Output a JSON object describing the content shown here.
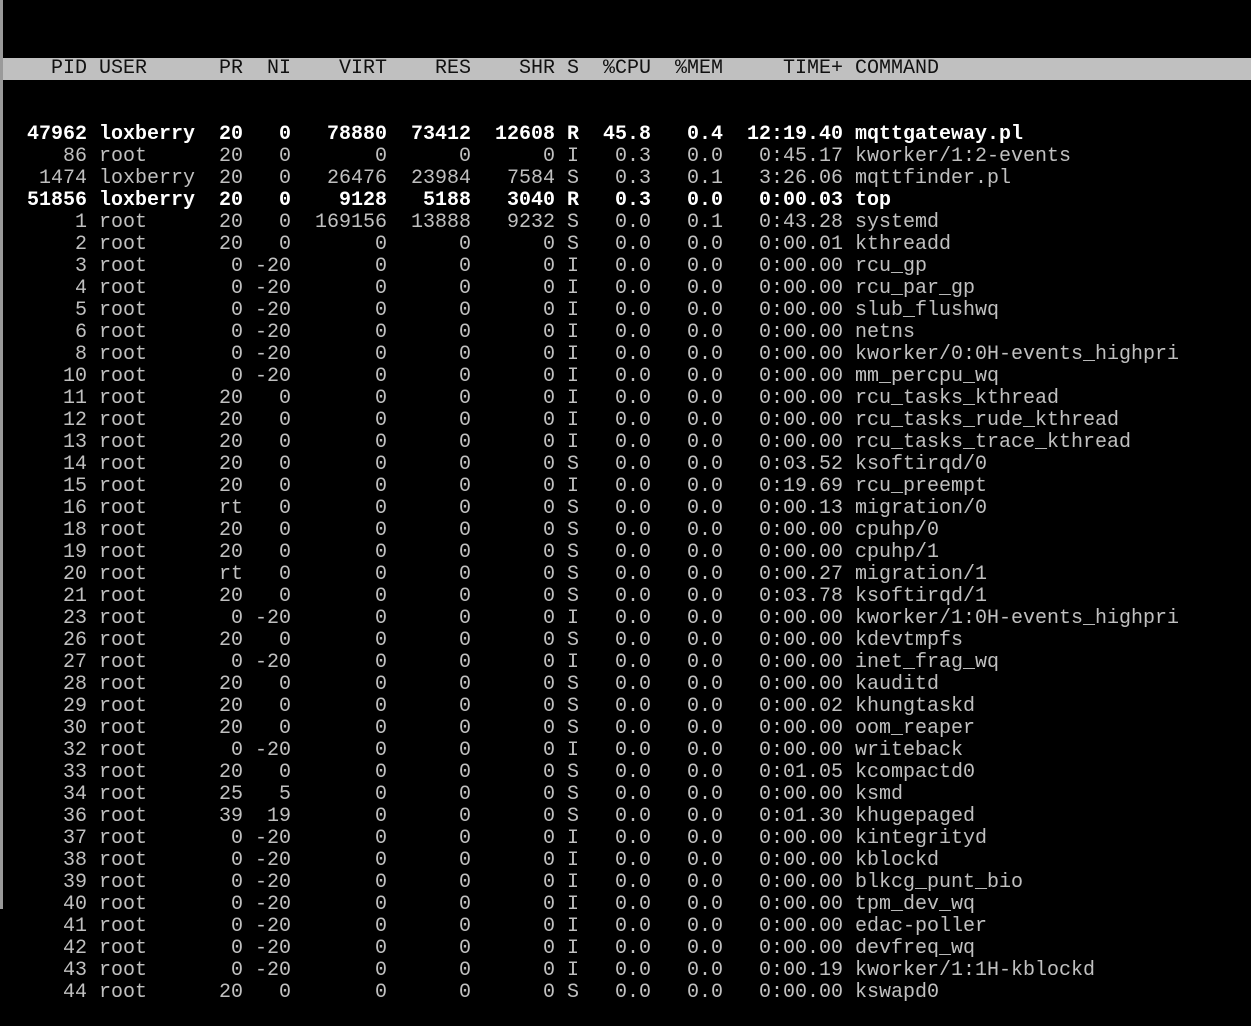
{
  "header": [
    "PID",
    "USER",
    "PR",
    "NI",
    "VIRT",
    "RES",
    "SHR",
    "S",
    "%CPU",
    "%MEM",
    "TIME+",
    "COMMAND"
  ],
  "colors": {
    "background": "#000000",
    "text": "#c0c0c0",
    "header_bg": "#c0c0c0",
    "running_text": "#ffffff"
  },
  "processes": [
    [
      "47962",
      "loxberry",
      "20",
      "0",
      "78880",
      "73412",
      "12608",
      "R",
      "45.8",
      "0.4",
      "12:19.40",
      "mqttgateway.pl"
    ],
    [
      "86",
      "root",
      "20",
      "0",
      "0",
      "0",
      "0",
      "I",
      "0.3",
      "0.0",
      "0:45.17",
      "kworker/1:2-events"
    ],
    [
      "1474",
      "loxberry",
      "20",
      "0",
      "26476",
      "23984",
      "7584",
      "S",
      "0.3",
      "0.1",
      "3:26.06",
      "mqttfinder.pl"
    ],
    [
      "51856",
      "loxberry",
      "20",
      "0",
      "9128",
      "5188",
      "3040",
      "R",
      "0.3",
      "0.0",
      "0:00.03",
      "top"
    ],
    [
      "1",
      "root",
      "20",
      "0",
      "169156",
      "13888",
      "9232",
      "S",
      "0.0",
      "0.1",
      "0:43.28",
      "systemd"
    ],
    [
      "2",
      "root",
      "20",
      "0",
      "0",
      "0",
      "0",
      "S",
      "0.0",
      "0.0",
      "0:00.01",
      "kthreadd"
    ],
    [
      "3",
      "root",
      "0",
      "-20",
      "0",
      "0",
      "0",
      "I",
      "0.0",
      "0.0",
      "0:00.00",
      "rcu_gp"
    ],
    [
      "4",
      "root",
      "0",
      "-20",
      "0",
      "0",
      "0",
      "I",
      "0.0",
      "0.0",
      "0:00.00",
      "rcu_par_gp"
    ],
    [
      "5",
      "root",
      "0",
      "-20",
      "0",
      "0",
      "0",
      "I",
      "0.0",
      "0.0",
      "0:00.00",
      "slub_flushwq"
    ],
    [
      "6",
      "root",
      "0",
      "-20",
      "0",
      "0",
      "0",
      "I",
      "0.0",
      "0.0",
      "0:00.00",
      "netns"
    ],
    [
      "8",
      "root",
      "0",
      "-20",
      "0",
      "0",
      "0",
      "I",
      "0.0",
      "0.0",
      "0:00.00",
      "kworker/0:0H-events_highpri"
    ],
    [
      "10",
      "root",
      "0",
      "-20",
      "0",
      "0",
      "0",
      "I",
      "0.0",
      "0.0",
      "0:00.00",
      "mm_percpu_wq"
    ],
    [
      "11",
      "root",
      "20",
      "0",
      "0",
      "0",
      "0",
      "I",
      "0.0",
      "0.0",
      "0:00.00",
      "rcu_tasks_kthread"
    ],
    [
      "12",
      "root",
      "20",
      "0",
      "0",
      "0",
      "0",
      "I",
      "0.0",
      "0.0",
      "0:00.00",
      "rcu_tasks_rude_kthread"
    ],
    [
      "13",
      "root",
      "20",
      "0",
      "0",
      "0",
      "0",
      "I",
      "0.0",
      "0.0",
      "0:00.00",
      "rcu_tasks_trace_kthread"
    ],
    [
      "14",
      "root",
      "20",
      "0",
      "0",
      "0",
      "0",
      "S",
      "0.0",
      "0.0",
      "0:03.52",
      "ksoftirqd/0"
    ],
    [
      "15",
      "root",
      "20",
      "0",
      "0",
      "0",
      "0",
      "I",
      "0.0",
      "0.0",
      "0:19.69",
      "rcu_preempt"
    ],
    [
      "16",
      "root",
      "rt",
      "0",
      "0",
      "0",
      "0",
      "S",
      "0.0",
      "0.0",
      "0:00.13",
      "migration/0"
    ],
    [
      "18",
      "root",
      "20",
      "0",
      "0",
      "0",
      "0",
      "S",
      "0.0",
      "0.0",
      "0:00.00",
      "cpuhp/0"
    ],
    [
      "19",
      "root",
      "20",
      "0",
      "0",
      "0",
      "0",
      "S",
      "0.0",
      "0.0",
      "0:00.00",
      "cpuhp/1"
    ],
    [
      "20",
      "root",
      "rt",
      "0",
      "0",
      "0",
      "0",
      "S",
      "0.0",
      "0.0",
      "0:00.27",
      "migration/1"
    ],
    [
      "21",
      "root",
      "20",
      "0",
      "0",
      "0",
      "0",
      "S",
      "0.0",
      "0.0",
      "0:03.78",
      "ksoftirqd/1"
    ],
    [
      "23",
      "root",
      "0",
      "-20",
      "0",
      "0",
      "0",
      "I",
      "0.0",
      "0.0",
      "0:00.00",
      "kworker/1:0H-events_highpri"
    ],
    [
      "26",
      "root",
      "20",
      "0",
      "0",
      "0",
      "0",
      "S",
      "0.0",
      "0.0",
      "0:00.00",
      "kdevtmpfs"
    ],
    [
      "27",
      "root",
      "0",
      "-20",
      "0",
      "0",
      "0",
      "I",
      "0.0",
      "0.0",
      "0:00.00",
      "inet_frag_wq"
    ],
    [
      "28",
      "root",
      "20",
      "0",
      "0",
      "0",
      "0",
      "S",
      "0.0",
      "0.0",
      "0:00.00",
      "kauditd"
    ],
    [
      "29",
      "root",
      "20",
      "0",
      "0",
      "0",
      "0",
      "S",
      "0.0",
      "0.0",
      "0:00.02",
      "khungtaskd"
    ],
    [
      "30",
      "root",
      "20",
      "0",
      "0",
      "0",
      "0",
      "S",
      "0.0",
      "0.0",
      "0:00.00",
      "oom_reaper"
    ],
    [
      "32",
      "root",
      "0",
      "-20",
      "0",
      "0",
      "0",
      "I",
      "0.0",
      "0.0",
      "0:00.00",
      "writeback"
    ],
    [
      "33",
      "root",
      "20",
      "0",
      "0",
      "0",
      "0",
      "S",
      "0.0",
      "0.0",
      "0:01.05",
      "kcompactd0"
    ],
    [
      "34",
      "root",
      "25",
      "5",
      "0",
      "0",
      "0",
      "S",
      "0.0",
      "0.0",
      "0:00.00",
      "ksmd"
    ],
    [
      "36",
      "root",
      "39",
      "19",
      "0",
      "0",
      "0",
      "S",
      "0.0",
      "0.0",
      "0:01.30",
      "khugepaged"
    ],
    [
      "37",
      "root",
      "0",
      "-20",
      "0",
      "0",
      "0",
      "I",
      "0.0",
      "0.0",
      "0:00.00",
      "kintegrityd"
    ],
    [
      "38",
      "root",
      "0",
      "-20",
      "0",
      "0",
      "0",
      "I",
      "0.0",
      "0.0",
      "0:00.00",
      "kblockd"
    ],
    [
      "39",
      "root",
      "0",
      "-20",
      "0",
      "0",
      "0",
      "I",
      "0.0",
      "0.0",
      "0:00.00",
      "blkcg_punt_bio"
    ],
    [
      "40",
      "root",
      "0",
      "-20",
      "0",
      "0",
      "0",
      "I",
      "0.0",
      "0.0",
      "0:00.00",
      "tpm_dev_wq"
    ],
    [
      "41",
      "root",
      "0",
      "-20",
      "0",
      "0",
      "0",
      "I",
      "0.0",
      "0.0",
      "0:00.00",
      "edac-poller"
    ],
    [
      "42",
      "root",
      "0",
      "-20",
      "0",
      "0",
      "0",
      "I",
      "0.0",
      "0.0",
      "0:00.00",
      "devfreq_wq"
    ],
    [
      "43",
      "root",
      "0",
      "-20",
      "0",
      "0",
      "0",
      "I",
      "0.0",
      "0.0",
      "0:00.19",
      "kworker/1:1H-kblockd"
    ],
    [
      "44",
      "root",
      "20",
      "0",
      "0",
      "0",
      "0",
      "S",
      "0.0",
      "0.0",
      "0:00.00",
      "kswapd0"
    ]
  ]
}
